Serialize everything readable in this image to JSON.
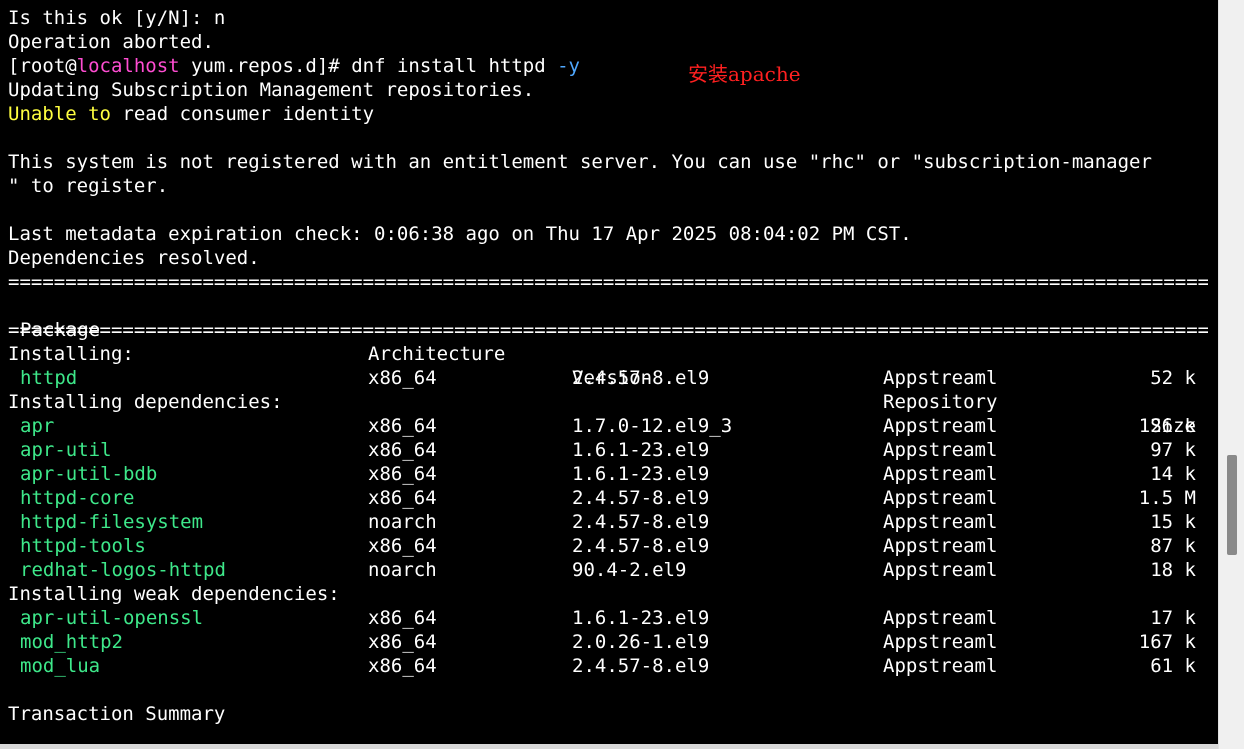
{
  "terminal": {
    "line1": "Is this ok [y/N]: n",
    "line2": "Operation aborted.",
    "prompt": {
      "user_prefix": "[root@",
      "host": "localhost",
      "path_suffix": " yum.repos.d]# ",
      "command": "dnf install httpd ",
      "flag": "-y"
    },
    "line4": "Updating Subscription Management repositories.",
    "line5": {
      "warn_part": "Unable to",
      "rest": " read consumer identity"
    },
    "line7": "This system is not registered with an entitlement server. You can use \"rhc\" or \"subscription-manager",
    "line8": "\" to register.",
    "line10": "Last metadata expiration check: 0:06:38 ago on Thu 17 Apr 2025 08:04:02 PM CST.",
    "line11": "Dependencies resolved.",
    "separator": "===================================================================================================================================================",
    "headers": {
      "package": "Package",
      "arch": "Architecture",
      "version": "Version",
      "repo": "Repository",
      "size": "Size"
    },
    "sections": [
      {
        "title": "Installing:",
        "rows": [
          {
            "pkg": "httpd",
            "arch": "x86_64",
            "ver": "2.4.57-8.el9",
            "repo": "Appstreaml",
            "size": "52 k"
          }
        ]
      },
      {
        "title": "Installing dependencies:",
        "rows": [
          {
            "pkg": "apr",
            "arch": "x86_64",
            "ver": "1.7.0-12.el9_3",
            "repo": "Appstreaml",
            "size": "126 k"
          },
          {
            "pkg": "apr-util",
            "arch": "x86_64",
            "ver": "1.6.1-23.el9",
            "repo": "Appstreaml",
            "size": "97 k"
          },
          {
            "pkg": "apr-util-bdb",
            "arch": "x86_64",
            "ver": "1.6.1-23.el9",
            "repo": "Appstreaml",
            "size": "14 k"
          },
          {
            "pkg": "httpd-core",
            "arch": "x86_64",
            "ver": "2.4.57-8.el9",
            "repo": "Appstreaml",
            "size": "1.5 M"
          },
          {
            "pkg": "httpd-filesystem",
            "arch": "noarch",
            "ver": "2.4.57-8.el9",
            "repo": "Appstreaml",
            "size": "15 k"
          },
          {
            "pkg": "httpd-tools",
            "arch": "x86_64",
            "ver": "2.4.57-8.el9",
            "repo": "Appstreaml",
            "size": "87 k"
          },
          {
            "pkg": "redhat-logos-httpd",
            "arch": "noarch",
            "ver": "90.4-2.el9",
            "repo": "Appstreaml",
            "size": "18 k"
          }
        ]
      },
      {
        "title": "Installing weak dependencies:",
        "rows": [
          {
            "pkg": "apr-util-openssl",
            "arch": "x86_64",
            "ver": "1.6.1-23.el9",
            "repo": "Appstreaml",
            "size": "17 k"
          },
          {
            "pkg": "mod_http2",
            "arch": "x86_64",
            "ver": "2.0.26-1.el9",
            "repo": "Appstreaml",
            "size": "167 k"
          },
          {
            "pkg": "mod_lua",
            "arch": "x86_64",
            "ver": "2.4.57-8.el9",
            "repo": "Appstreaml",
            "size": "61 k"
          }
        ]
      }
    ],
    "summary_title": "Transaction Summary"
  },
  "annotation": "安装apache",
  "colors": {
    "background": "#000000",
    "text": "#ffffff",
    "host": "#ff4dd2",
    "flag": "#4fa8ff",
    "warning": "#ffff40",
    "package": "#3ee88a",
    "annotation": "#ff2020"
  }
}
